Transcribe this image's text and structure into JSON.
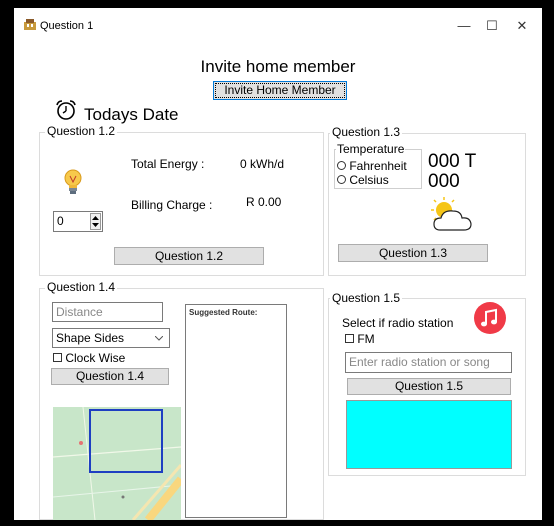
{
  "window": {
    "title": "Question 1",
    "minimize": "—",
    "maximize": "☐",
    "close": "✕"
  },
  "header": {
    "heading": "Invite home member",
    "invite_button": "Invite Home Member",
    "date_label": "Todays Date"
  },
  "q12": {
    "group_label": "Question 1.2",
    "total_energy_label": "Total Energy :",
    "total_energy_value": "0 kWh/d",
    "billing_label": "Billing Charge :",
    "billing_value": "R 0.00",
    "stepper_value": "0",
    "button": "Question 1.2"
  },
  "q13": {
    "group_label": "Question 1.3",
    "temp_group_label": "Temperature",
    "fahrenheit": "Fahrenheit",
    "celsius": "Celsius",
    "value_f": "000 T",
    "value_c": "000",
    "button": "Question 1.3"
  },
  "q14": {
    "group_label": "Question 1.4",
    "distance_placeholder": "Distance",
    "shape_select": "Shape Sides",
    "clockwise": "Clock Wise",
    "button": "Question 1.4",
    "route_label": "Suggested Route:"
  },
  "q15": {
    "group_label": "Question 1.5",
    "prompt": "Select if radio station",
    "fm": "FM",
    "station_placeholder": "Enter radio station or song",
    "button": "Question 1.5",
    "panel_color": "#00ffff"
  }
}
